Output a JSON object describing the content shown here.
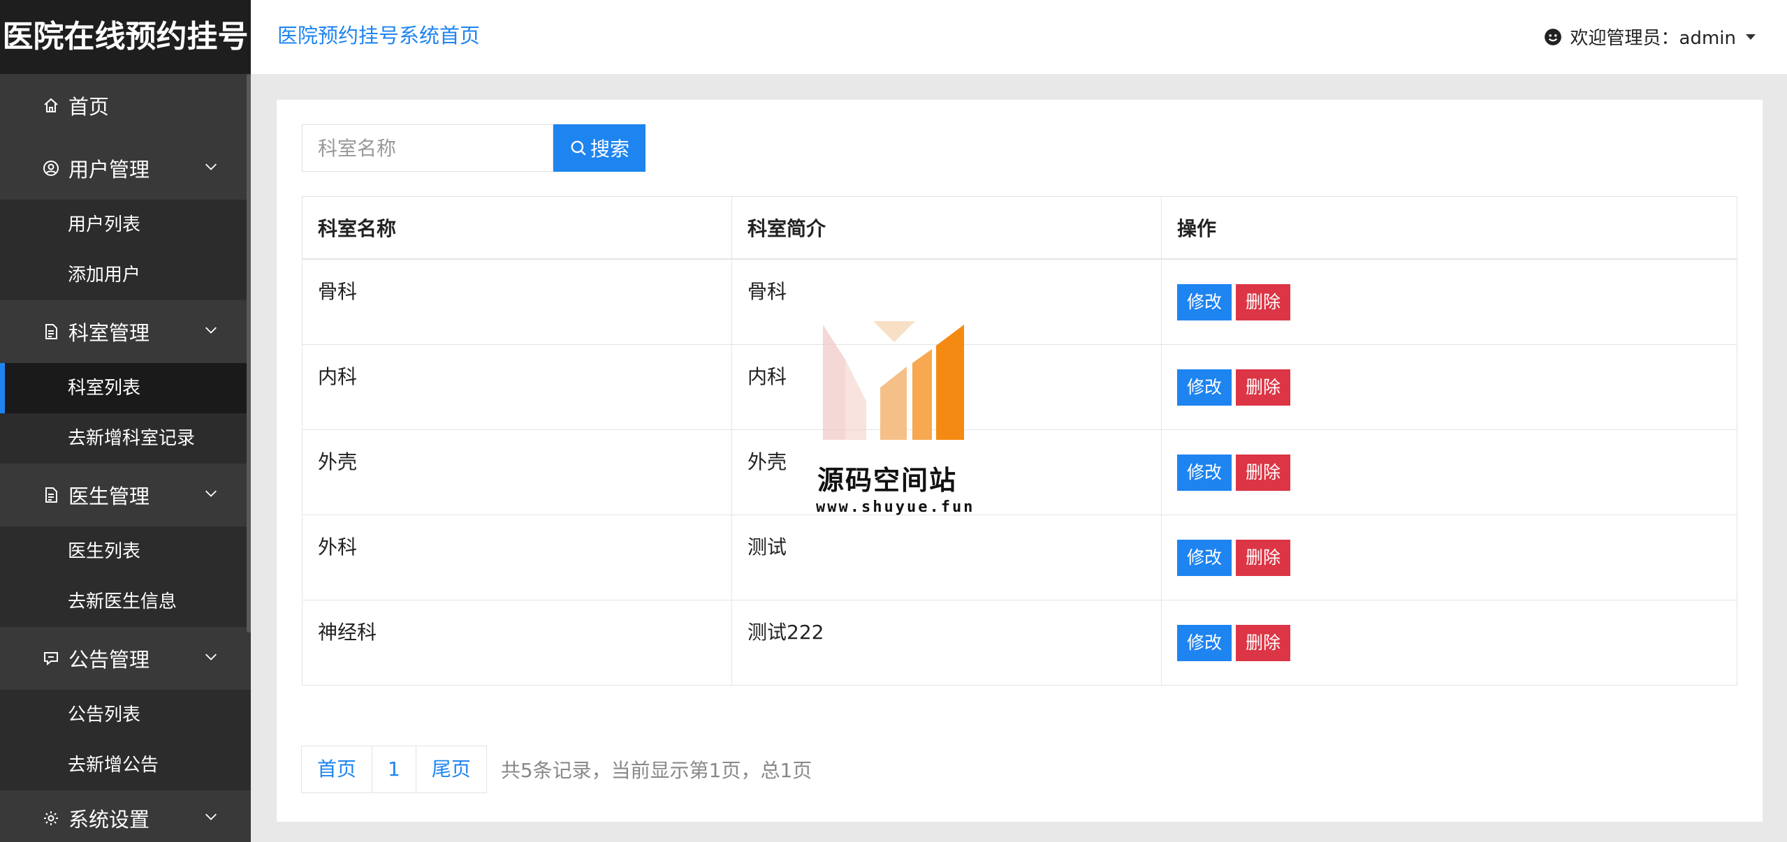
{
  "app": {
    "brand": "医院在线预约挂号",
    "header_link": "医院预约挂号系统首页",
    "user_greeting": "欢迎管理员：admin"
  },
  "sidebar": {
    "home": "首页",
    "groups": [
      {
        "label": "用户管理",
        "icon": "user-icon",
        "items": [
          "用户列表",
          "添加用户"
        ]
      },
      {
        "label": "科室管理",
        "icon": "document-icon",
        "items": [
          "科室列表",
          "去新增科室记录"
        ]
      },
      {
        "label": "医生管理",
        "icon": "document-icon",
        "items": [
          "医生列表",
          "去新医生信息"
        ]
      },
      {
        "label": "公告管理",
        "icon": "announcement-icon",
        "items": [
          "公告列表",
          "去新增公告"
        ]
      },
      {
        "label": "系统设置",
        "icon": "gear-icon",
        "items": []
      }
    ],
    "active_item": "科室列表"
  },
  "search": {
    "placeholder": "科室名称",
    "button": "搜索"
  },
  "table": {
    "headers": [
      "科室名称",
      "科室简介",
      "操作"
    ],
    "rows": [
      {
        "name": "骨科",
        "intro": "骨科"
      },
      {
        "name": "内科",
        "intro": "内科"
      },
      {
        "name": "外壳",
        "intro": "外壳"
      },
      {
        "name": "外科",
        "intro": "测试"
      },
      {
        "name": "神经科",
        "intro": "测试222"
      }
    ],
    "edit_label": "修改",
    "delete_label": "删除"
  },
  "pager": {
    "first": "首页",
    "page": "1",
    "last": "尾页",
    "info": "共5条记录，当前显示第1页，总1页"
  },
  "watermark": {
    "name": "源码空间站",
    "url": "www.shuyue.fun"
  },
  "colors": {
    "primary": "#1e84f0",
    "danger": "#dc3545",
    "sidebar": "#393939",
    "sidebar_brand": "#1e1e1e"
  }
}
